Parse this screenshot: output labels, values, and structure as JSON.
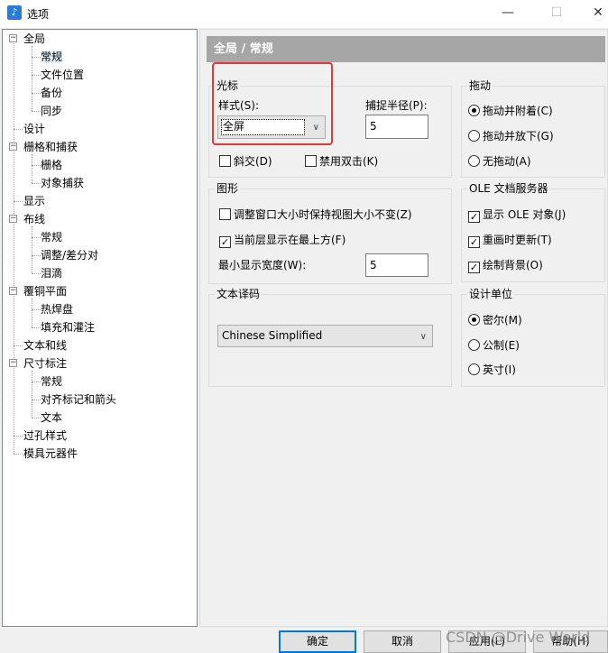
{
  "window": {
    "title": "选项",
    "app_icon": "app-icon"
  },
  "tree": {
    "items": [
      {
        "label": "全局"
      },
      {
        "label": "常规"
      },
      {
        "label": "文件位置"
      },
      {
        "label": "备份"
      },
      {
        "label": "同步"
      },
      {
        "label": "设计"
      },
      {
        "label": "栅格和捕获"
      },
      {
        "label": "栅格"
      },
      {
        "label": "对象捕获"
      },
      {
        "label": "显示"
      },
      {
        "label": "布线"
      },
      {
        "label": "常规"
      },
      {
        "label": "调整/差分对"
      },
      {
        "label": "泪滴"
      },
      {
        "label": "覆铜平面"
      },
      {
        "label": "热焊盘"
      },
      {
        "label": "填充和灌注"
      },
      {
        "label": "文本和线"
      },
      {
        "label": "尺寸标注"
      },
      {
        "label": "常规"
      },
      {
        "label": "对齐标记和箭头"
      },
      {
        "label": "文本"
      },
      {
        "label": "过孔样式"
      },
      {
        "label": "模具元器件"
      }
    ],
    "selected": "常规"
  },
  "panel": {
    "header": "全局 / 常规"
  },
  "cursor": {
    "group_title": "光标",
    "style_label": "样式(S):",
    "style_value": "全屏",
    "pick_radius_label": "捕捉半径(P):",
    "pick_radius_value": "5",
    "diagonal_label": "斜交(D)",
    "diagonal_checked": false,
    "disable_dblclick_label": "禁用双击(K)",
    "disable_dblclick_checked": false
  },
  "drag": {
    "group_title": "拖动",
    "options": [
      {
        "label": "拖动并附着(C)",
        "selected": true
      },
      {
        "label": "拖动并放下(G)",
        "selected": false
      },
      {
        "label": "无拖动(A)",
        "selected": false
      }
    ]
  },
  "graphics": {
    "group_title": "图形",
    "keep_view_label": "调整窗口大小时保持视图大小不变(Z)",
    "keep_view_checked": false,
    "current_layer_top_label": "当前层显示在最上方(F)",
    "current_layer_top_checked": true,
    "min_width_label": "最小显示宽度(W):",
    "min_width_value": "5"
  },
  "ole": {
    "group_title": "OLE 文档服务器",
    "options": [
      {
        "label": "显示 OLE 对象(J)",
        "checked": true
      },
      {
        "label": "重画时更新(T)",
        "checked": true
      },
      {
        "label": "绘制背景(O)",
        "checked": true
      }
    ]
  },
  "text_encoding": {
    "group_title": "文本译码",
    "value": "Chinese Simplified"
  },
  "design_units": {
    "group_title": "设计单位",
    "options": [
      {
        "label": "密尔(M)",
        "selected": true
      },
      {
        "label": "公制(E)",
        "selected": false
      },
      {
        "label": "英寸(I)",
        "selected": false
      }
    ]
  },
  "buttons": {
    "ok": "确定",
    "cancel": "取消",
    "apply": "应用(L)",
    "help": "帮助(H)"
  },
  "watermark": "CSDN @Drive World",
  "colors": {
    "header_bg": "#a6a6a6",
    "highlight_border": "#e63838",
    "default_button_border": "#0078d7"
  }
}
